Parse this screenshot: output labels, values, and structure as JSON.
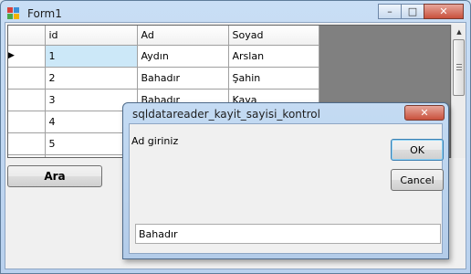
{
  "window": {
    "title": "Form1",
    "minimize": "–",
    "maximize": "□",
    "close": "✕"
  },
  "grid": {
    "columns": [
      "id",
      "Ad",
      "Soyad"
    ],
    "rows": [
      [
        "1",
        "Aydın",
        "Arslan"
      ],
      [
        "2",
        "Bahadır",
        "Şahin"
      ],
      [
        "3",
        "Bahadır",
        "Kaya"
      ],
      [
        "4",
        "",
        ""
      ],
      [
        "5",
        "",
        ""
      ],
      [
        "",
        "",
        ""
      ]
    ],
    "current_row_marker": "▶",
    "scroll_up": "▲",
    "scroll_down": "▼"
  },
  "buttons": {
    "search_label": "Ara"
  },
  "dialog": {
    "title": "sqldatareader_kayit_sayisi_kontrol",
    "close": "✕",
    "prompt": "Ad giriniz",
    "ok_label": "OK",
    "cancel_label": "Cancel",
    "input_value": "Bahadır"
  },
  "colors": {
    "selection": "#cce8f8",
    "grid_background": "#808080",
    "close_button": "#c9513c"
  }
}
